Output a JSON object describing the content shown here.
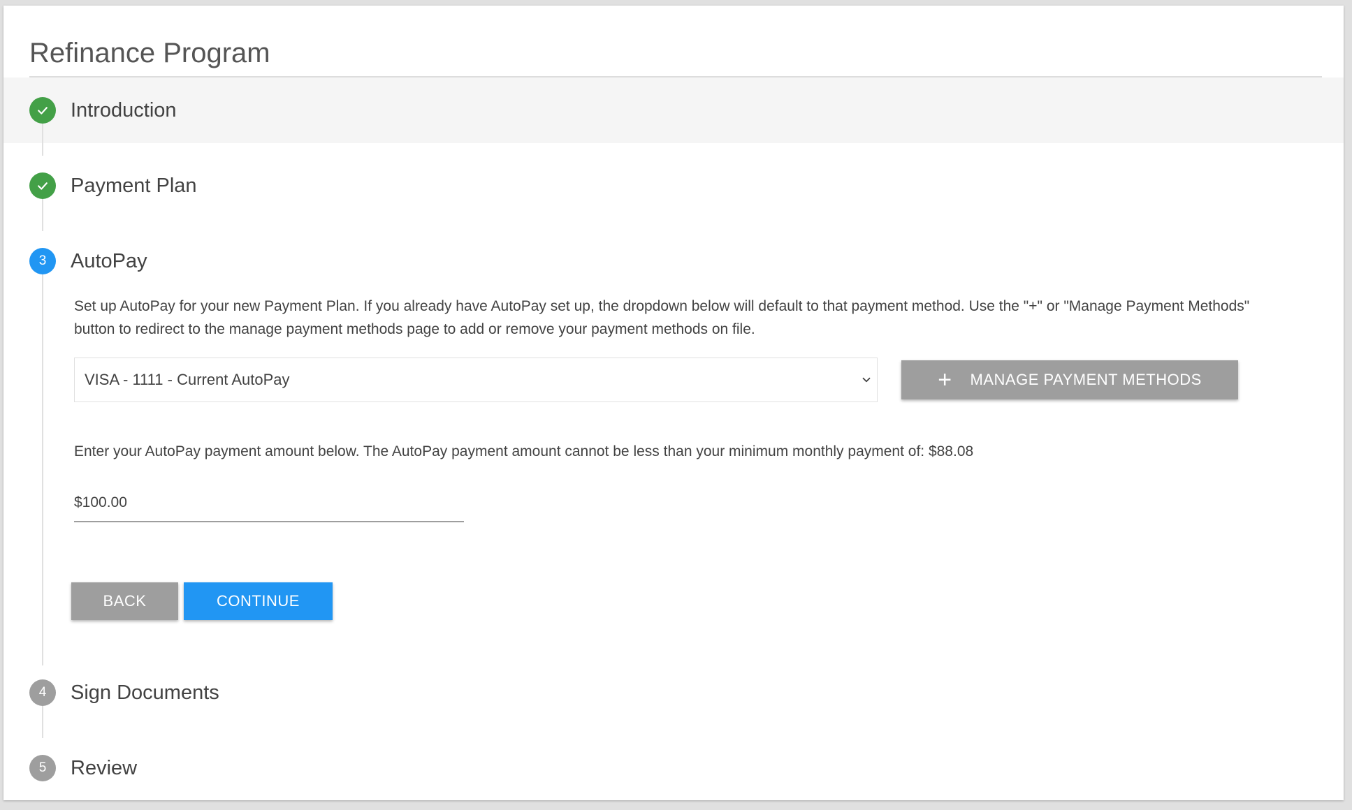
{
  "page": {
    "title": "Refinance Program"
  },
  "steps": [
    {
      "label": "Introduction",
      "status": "complete",
      "icon": "check-icon"
    },
    {
      "label": "Payment Plan",
      "status": "complete",
      "icon": "check-icon"
    },
    {
      "label": "AutoPay",
      "status": "active",
      "number": "3"
    },
    {
      "label": "Sign Documents",
      "status": "pending",
      "number": "4"
    },
    {
      "label": "Review",
      "status": "pending",
      "number": "5"
    }
  ],
  "autopay": {
    "description": "Set up AutoPay for your new Payment Plan. If you already have AutoPay set up, the dropdown below will default to that payment method. Use the \"+\" or \"Manage Payment Methods\" button to redirect to the manage payment methods page to add or remove your payment methods on file.",
    "payment_method_selected": "VISA - 1111 - Current AutoPay",
    "manage_button_label": "MANAGE PAYMENT METHODS",
    "amount_instruction": "Enter your AutoPay payment amount below. The AutoPay payment amount cannot be less than your minimum monthly payment of: $88.08",
    "amount_value": "$100.00",
    "back_label": "BACK",
    "continue_label": "CONTINUE"
  },
  "colors": {
    "complete": "#43a047",
    "active": "#2196f3",
    "pending": "#9e9e9e",
    "primary_button": "#2196f3",
    "secondary_button": "#9e9e9e"
  }
}
